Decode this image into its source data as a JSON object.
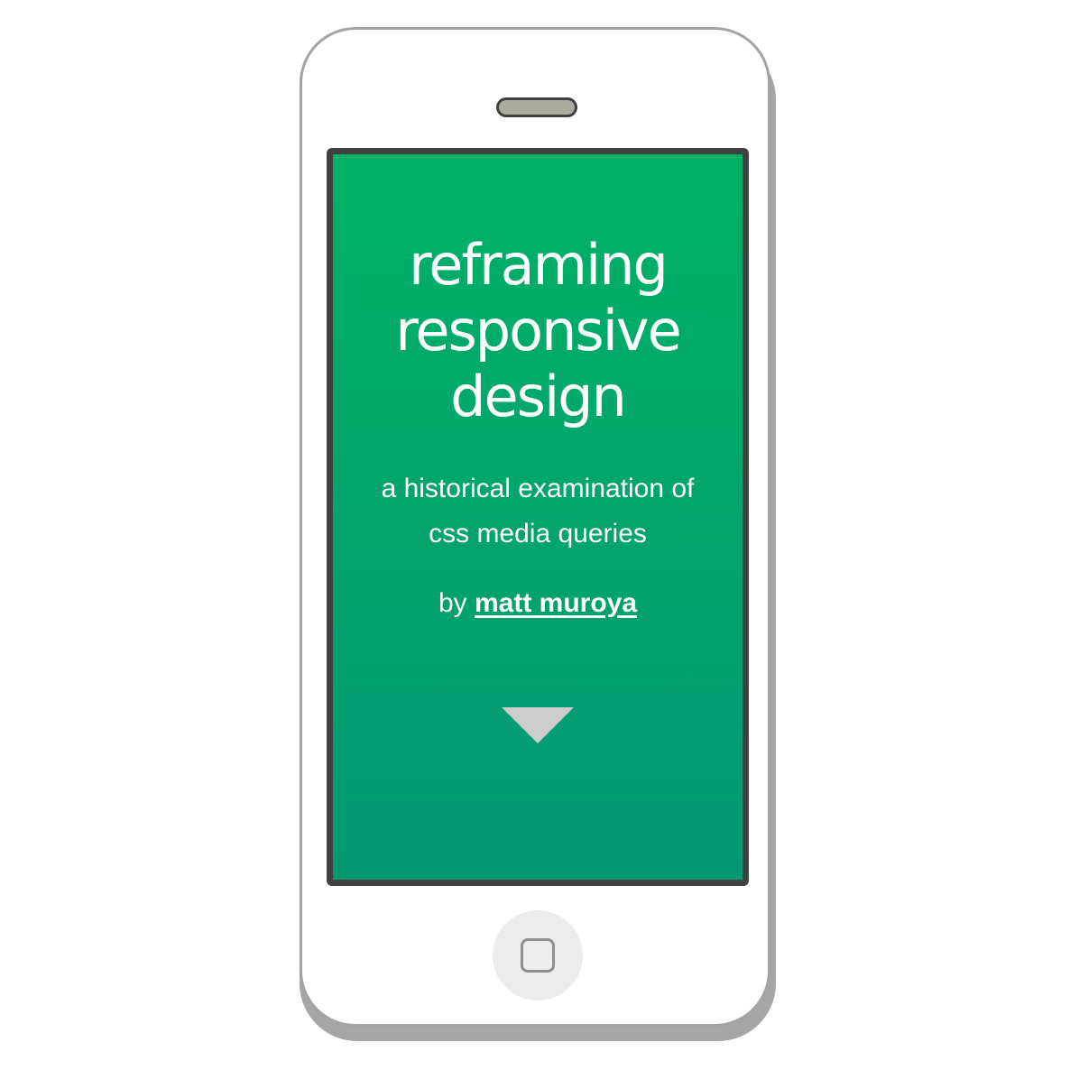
{
  "screen": {
    "title": "reframing\nresponsive\ndesign",
    "subtitle": "a historical examination of\ncss media queries",
    "byline": {
      "prefix": "by ",
      "author_link": "matt muroya"
    },
    "scroll_down_icon": "triangle-down-icon"
  },
  "device": {
    "type": "smartphone",
    "home_button_icon": "rounded-square-icon",
    "colors": {
      "screen_gradient_top": "#00b166",
      "screen_gradient_bottom": "#039872",
      "screen_border": "#414141",
      "body": "#ffffff",
      "body_outline": "#a3a3a3",
      "speaker": "#adaa9f",
      "arrow": "#cecece"
    }
  }
}
